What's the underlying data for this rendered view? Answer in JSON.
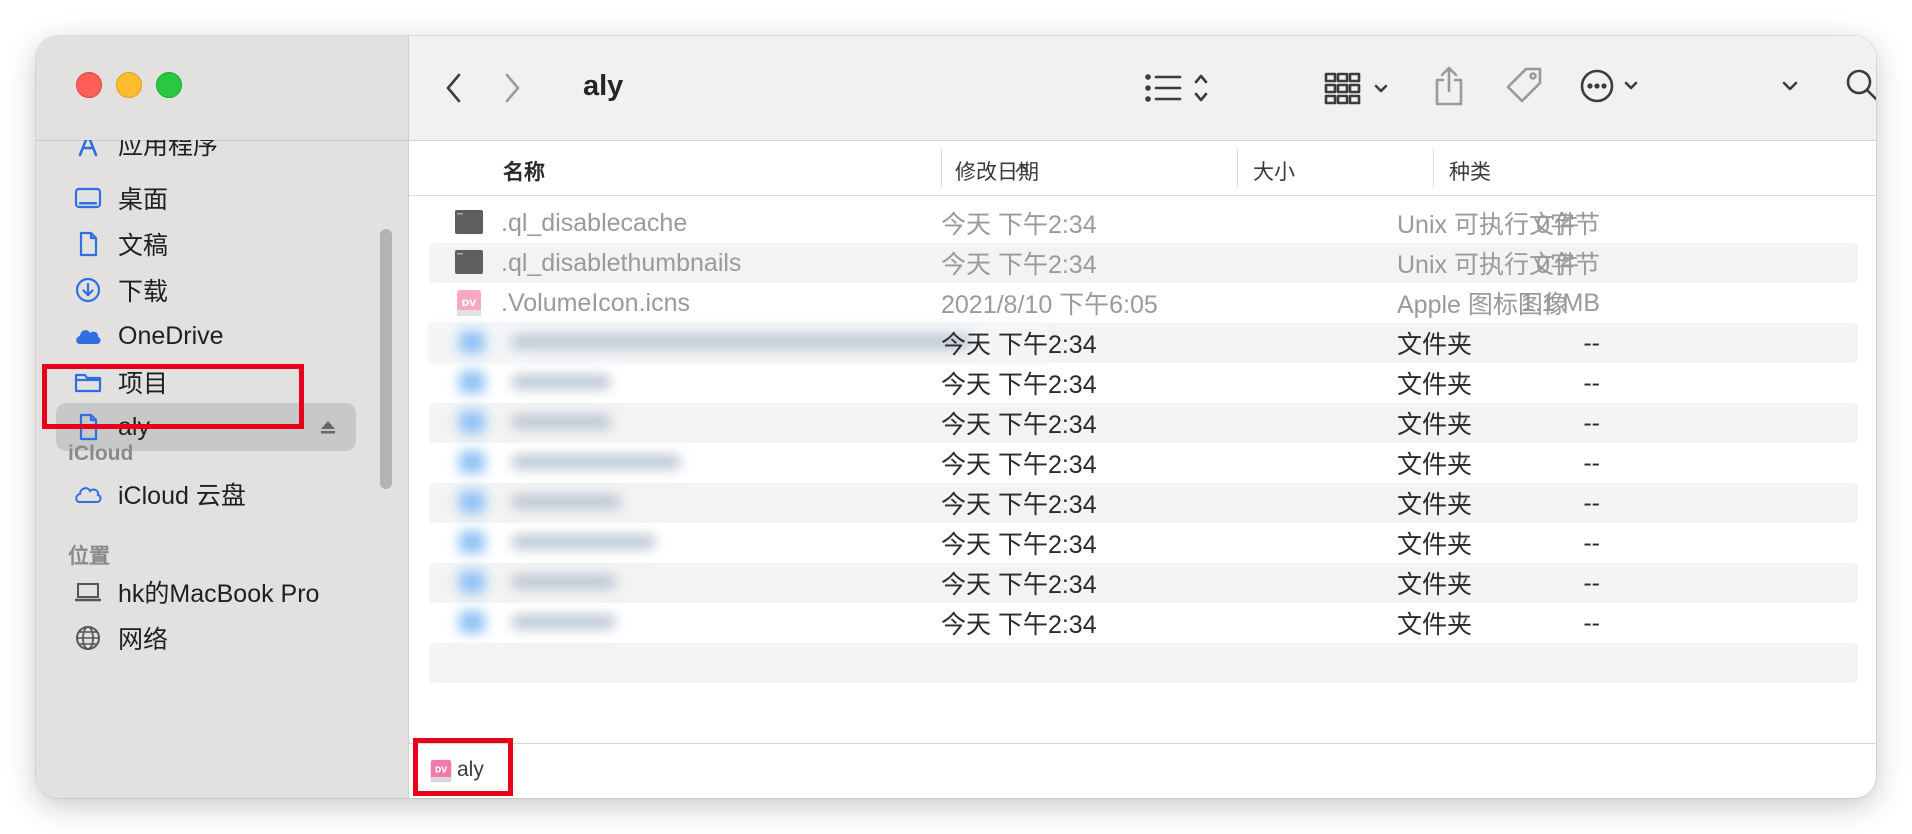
{
  "window": {
    "title": "aly"
  },
  "sidebar": {
    "partial_item": "应用程序",
    "favorites": [
      {
        "label": "桌面",
        "icon": "desktop-icon"
      },
      {
        "label": "文稿",
        "icon": "document-icon"
      },
      {
        "label": "下载",
        "icon": "download-icon"
      },
      {
        "label": "OneDrive",
        "icon": "cloud-icon"
      },
      {
        "label": "项目",
        "icon": "folder-icon"
      },
      {
        "label": "aly",
        "icon": "disk-image-icon"
      }
    ],
    "icloud_header": "iCloud",
    "icloud_item": "iCloud 云盘",
    "locations_header": "位置",
    "locations": [
      {
        "label": "hk的MacBook Pro",
        "icon": "laptop-icon"
      },
      {
        "label": "网络",
        "icon": "network-icon"
      }
    ]
  },
  "columns": {
    "name": "名称",
    "date": "修改日期",
    "size": "大小",
    "kind": "种类"
  },
  "files": [
    {
      "name": ".ql_disablecache",
      "date": "今天 下午2:34",
      "size": "0字节",
      "kind": "Unix 可执行文件"
    },
    {
      "name": ".ql_disablethumbnails",
      "date": "今天 下午2:34",
      "size": "0字节",
      "kind": "Unix 可执行文件"
    },
    {
      "name": ".VolumeIcon.icns",
      "date": "2021/8/10 下午6:05",
      "size": "1.1 MB",
      "kind": "Apple 图标图像"
    }
  ],
  "folders": [
    {
      "date": "今天 下午2:34",
      "size": "--",
      "kind": "文件夹"
    },
    {
      "date": "今天 下午2:34",
      "size": "--",
      "kind": "文件夹"
    },
    {
      "date": "今天 下午2:34",
      "size": "--",
      "kind": "文件夹"
    },
    {
      "date": "今天 下午2:34",
      "size": "--",
      "kind": "文件夹"
    },
    {
      "date": "今天 下午2:34",
      "size": "--",
      "kind": "文件夹"
    },
    {
      "date": "今天 下午2:34",
      "size": "--",
      "kind": "文件夹"
    },
    {
      "date": "今天 下午2:34",
      "size": "--",
      "kind": "文件夹"
    },
    {
      "date": "今天 下午2:34",
      "size": "--",
      "kind": "文件夹"
    }
  ],
  "pathbar": {
    "label": "aly"
  },
  "colors": {
    "highlight": "#e8001b",
    "selected_bg": "#c8c8c8",
    "sidebar_bg": "#e2e1e0"
  }
}
